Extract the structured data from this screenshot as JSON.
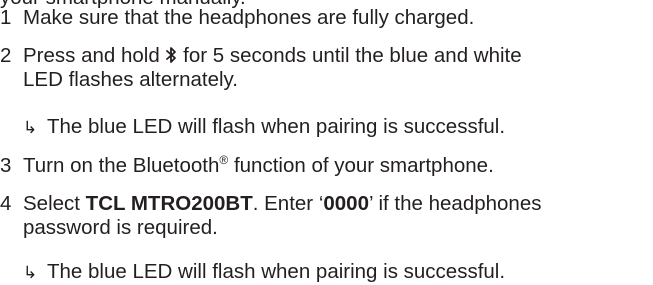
{
  "intro_tail": "your smartphone manually.",
  "steps": [
    {
      "number": "1",
      "text": "Make sure that the headphones are fully charged."
    },
    {
      "number": "2",
      "text_before_icon": "Press and hold",
      "icon": "bluetooth-icon",
      "text_after_icon": "for 5 seconds until the blue and white",
      "line2": "LED flashes alternately.",
      "result_arrow": "↳",
      "result": "The blue LED will flash when pairing is successful."
    },
    {
      "number": "3",
      "text_before_sup": "Turn on the Bluetooth",
      "sup": "®",
      "text_after_sup": " function of your smartphone."
    },
    {
      "number": "4",
      "select_word": "Select ",
      "device_name": "TCL MTRO200BT",
      "mid_text": ". Enter ‘",
      "password": "0000",
      "end_text": "’ if the headphones",
      "line2": "password is required.",
      "result_arrow": "↳",
      "result": "The blue LED will flash when pairing is successful."
    }
  ],
  "colors": {
    "text": "#231f20",
    "background": "#ffffff"
  }
}
